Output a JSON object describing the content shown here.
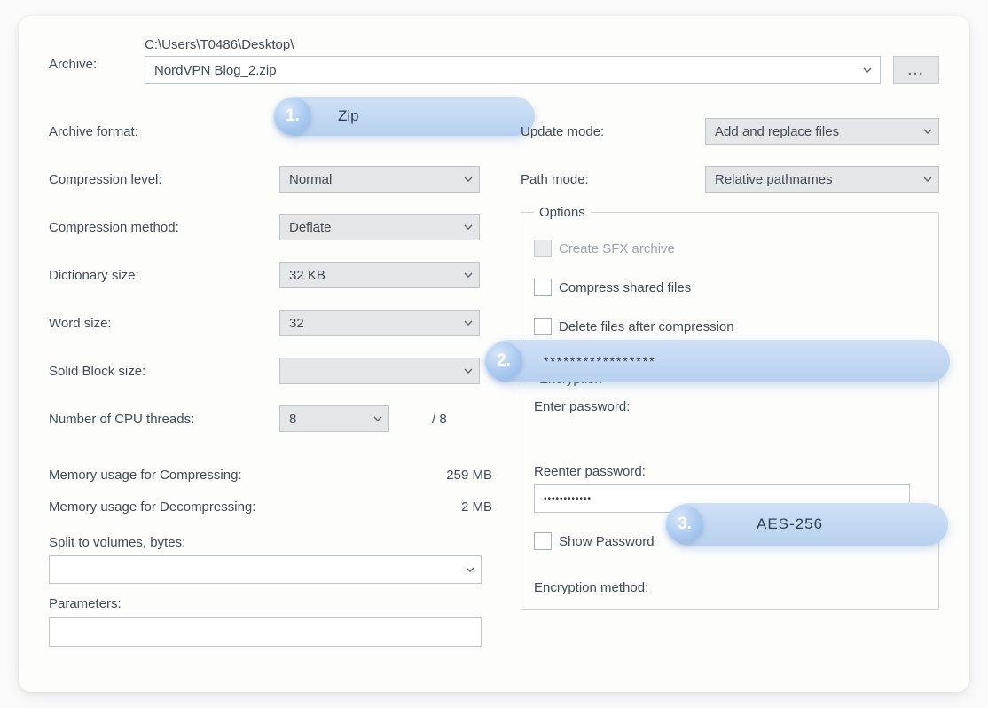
{
  "archive_label": "Archive:",
  "archive_path": "C:\\Users\\T0486\\Desktop\\",
  "archive_filename": "NordVPN Blog_2.zip",
  "browse_label": "...",
  "left": {
    "archive_format_label": "Archive format:",
    "archive_format_value": "Zip",
    "compression_level_label": "Compression level:",
    "compression_level_value": "Normal",
    "compression_method_label": "Compression method:",
    "compression_method_value": "Deflate",
    "dictionary_size_label": "Dictionary size:",
    "dictionary_size_value": "32 KB",
    "word_size_label": "Word size:",
    "word_size_value": "32",
    "solid_block_label": "Solid Block size:",
    "solid_block_value": "",
    "cpu_threads_label": "Number of CPU threads:",
    "cpu_threads_value": "8",
    "cpu_threads_max": "/ 8",
    "mem_compress_label": "Memory usage for Compressing:",
    "mem_compress_value": "259 MB",
    "mem_decompress_label": "Memory usage for Decompressing:",
    "mem_decompress_value": "2 MB",
    "split_label": "Split to volumes, bytes:",
    "parameters_label": "Parameters:"
  },
  "right": {
    "update_mode_label": "Update mode:",
    "update_mode_value": "Add and replace files",
    "path_mode_label": "Path mode:",
    "path_mode_value": "Relative pathnames",
    "options_legend": "Options",
    "opt_sfx": "Create SFX archive",
    "opt_shared": "Compress shared files",
    "opt_delete": "Delete files after compression",
    "encryption_legend": "Encryption",
    "enter_pw_label": "Enter password:",
    "password_masked": "*****************",
    "reenter_pw_label": "Reenter password:",
    "reenter_masked": "••••••••••••",
    "show_pw_label": "Show Password",
    "enc_method_label": "Encryption method:",
    "enc_method_value": "AES-256"
  },
  "steps": {
    "one": "1.",
    "one_text": "Zip",
    "two": "2.",
    "two_text": "*****************",
    "three": "3.",
    "three_text": "AES-256"
  }
}
